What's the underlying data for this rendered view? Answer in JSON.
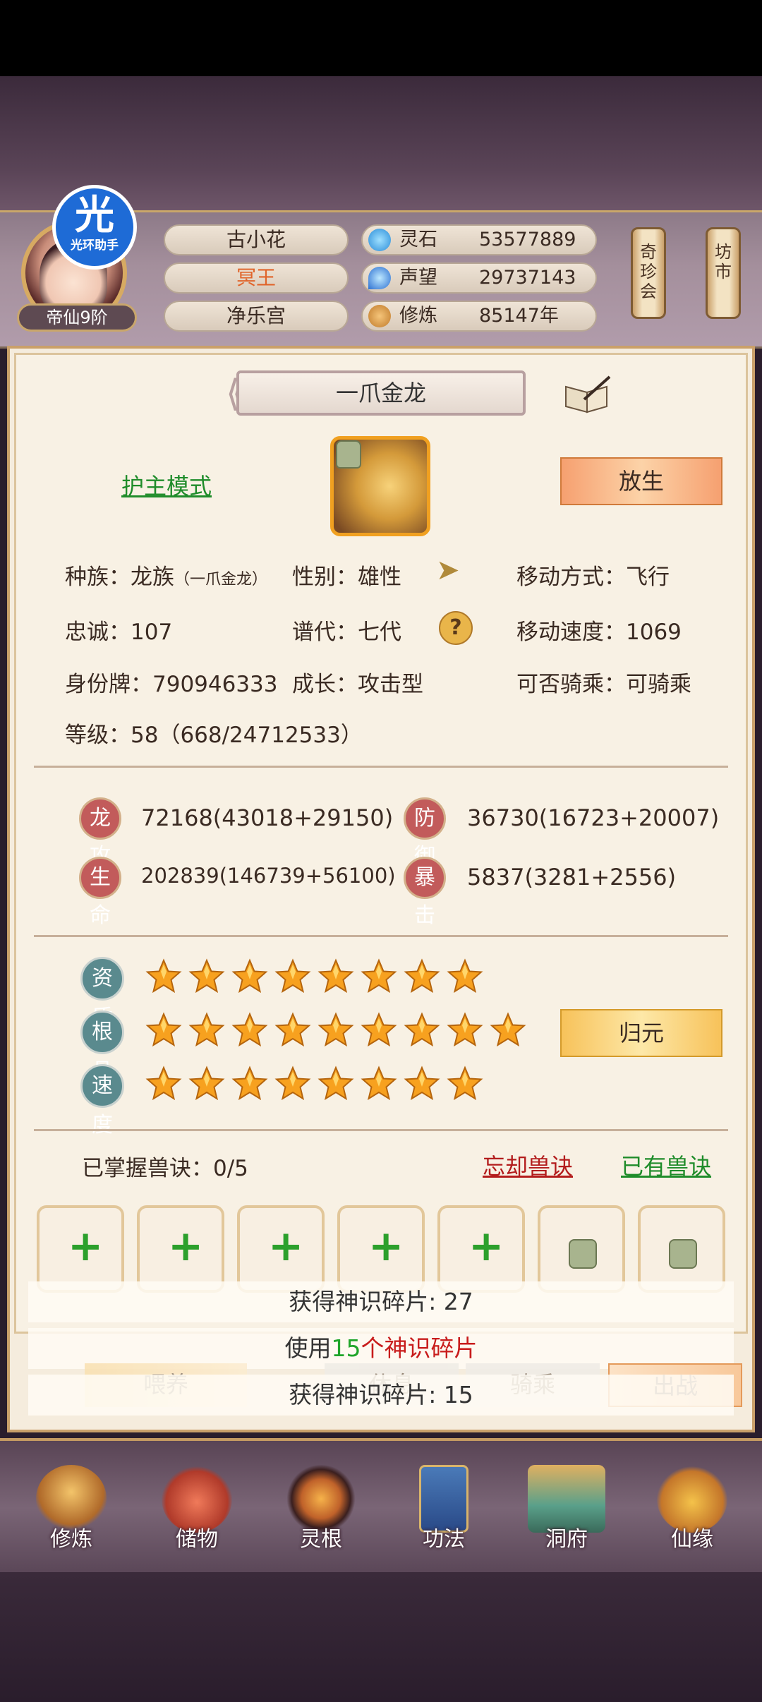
{
  "header": {
    "halo_badge": {
      "char": "光",
      "label": "光环助手"
    },
    "rank": "帝仙9阶",
    "names": [
      "古小花",
      "冥王",
      "净乐宫"
    ],
    "name_colors": [
      "#3a2a22",
      "#e0642a",
      "#3a2a22"
    ],
    "resources": [
      {
        "icon": "spirit-stone-icon",
        "label": "灵石",
        "value": "53577889"
      },
      {
        "icon": "reputation-icon",
        "label": "声望",
        "value": "29737143"
      },
      {
        "icon": "cultivation-icon",
        "label": "修炼",
        "value": "85147年"
      }
    ],
    "scrolls": [
      {
        "text": "奇珍会"
      },
      {
        "text": "坊市"
      }
    ]
  },
  "pet": {
    "name": "一爪金龙",
    "guard_mode": "护主模式",
    "release_button": "放生",
    "info": {
      "race_label": "种族：龙族",
      "race_sub": "（一爪金龙）",
      "gender": "性别：雄性",
      "move_mode": "移动方式：飞行",
      "loyalty": "忠诚：107",
      "generation": "谱代：七代",
      "move_speed": "移动速度：1069",
      "id_tag": "身份牌：790946333",
      "growth": "成长：攻击型",
      "rideable": "可否骑乘：可骑乘",
      "level": "等级：58（668/24712533）"
    },
    "stats": [
      {
        "badge": "龙攻",
        "value": "72168(43018+29150)"
      },
      {
        "badge": "防御",
        "value": "36730(16723+20007)"
      },
      {
        "badge": "生命",
        "value": "202839(146739+56100)"
      },
      {
        "badge": "暴击",
        "value": "5837(3281+2556)"
      }
    ],
    "aptitudes": [
      {
        "label": "资质",
        "stars": 8
      },
      {
        "label": "根骨",
        "stars": 9
      },
      {
        "label": "速度",
        "stars": 8
      }
    ],
    "reset_button": "归元",
    "skills": {
      "mastered": "已掌握兽诀：0/5",
      "forget": "忘却兽诀",
      "owned": "已有兽诀",
      "slots": [
        "plus",
        "plus",
        "plus",
        "plus",
        "plus",
        "locked",
        "locked"
      ]
    }
  },
  "toasts": {
    "line1": "获得神识碎片: 27",
    "line2_pre": "使用",
    "line2_num": "15",
    "line2_mid": "个",
    "line2_item": "神识碎片",
    "line3": "获得神识碎片: 15"
  },
  "bottom_buttons": [
    "喂养",
    "休息",
    "骑乘",
    "出战"
  ],
  "nav": [
    {
      "label": "修炼",
      "icon": "cultivation-monk-icon"
    },
    {
      "label": "储物",
      "icon": "storage-bag-icon"
    },
    {
      "label": "灵根",
      "icon": "spirit-root-icon"
    },
    {
      "label": "功法",
      "icon": "technique-book-icon"
    },
    {
      "label": "洞府",
      "icon": "cave-abode-icon"
    },
    {
      "label": "仙缘",
      "icon": "fortune-gourd-icon"
    }
  ]
}
